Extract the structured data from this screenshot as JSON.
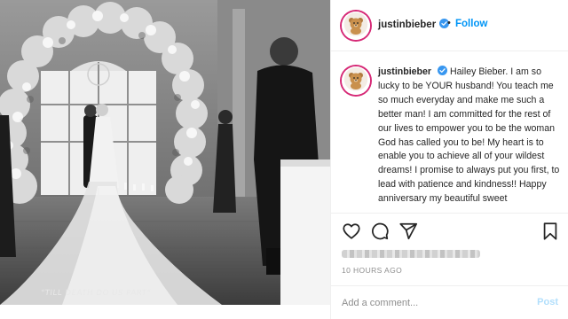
{
  "photo": {
    "alt_icon": "wedding-photo",
    "caption_overlay": "\"TILL DEATH DO US PART\""
  },
  "header": {
    "username": "justinbieber",
    "separator": "•",
    "follow_label": "Follow"
  },
  "caption": {
    "username": "justinbieber",
    "text": "Hailey Bieber. I am so lucky to be YOUR husband! You teach me so much everyday and make me such a better man! I am committed for the rest of our lives to empower you to be the woman God has called you to be! My heart is to enable you to achieve all of your wildest dreams! I promise to always put you first, to lead with patience and kindness!! Happy anniversary my beautiful sweet"
  },
  "actions": {
    "icons": [
      "heart-icon",
      "comment-icon",
      "share-icon",
      "bookmark-icon"
    ]
  },
  "meta": {
    "timestamp": "10 HOURS AGO"
  },
  "comment": {
    "placeholder": "Add a comment...",
    "post_label": "Post"
  },
  "colors": {
    "link_blue": "#0095f6",
    "post_disabled": "#b2dffc",
    "verified_blue": "#3897f0",
    "story_ring": "#d62976"
  }
}
